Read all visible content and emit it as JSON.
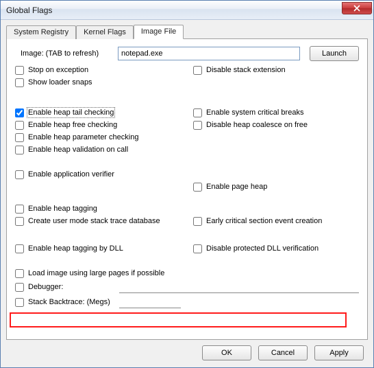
{
  "window": {
    "title": "Global Flags"
  },
  "tabs": {
    "registry": "System Registry",
    "kernel": "Kernel Flags",
    "imagefile": "Image File"
  },
  "image": {
    "label": "Image: (TAB to refresh)",
    "value": "notepad.exe",
    "launch": "Launch"
  },
  "opts": {
    "stop_exception": "Stop on exception",
    "show_loader": "Show loader snaps",
    "disable_stack_ext": "Disable stack extension",
    "heap_tail": "Enable heap tail checking",
    "heap_free": "Enable heap free checking",
    "heap_param": "Enable heap parameter checking",
    "heap_valid": "Enable heap validation on call",
    "sys_crit": "Enable system critical breaks",
    "disable_coalesce": "Disable heap coalesce on free",
    "app_verifier": "Enable application verifier",
    "page_heap": "Enable page heap",
    "heap_tag": "Enable heap tagging",
    "user_stack": "Create user mode stack trace database",
    "early_crit": "Early critical section event creation",
    "heap_tag_dll": "Enable heap tagging by DLL",
    "disable_prot_dll": "Disable protected DLL verification",
    "large_pages": "Load image using large pages if possible",
    "debugger": "Debugger:",
    "stack_bt": "Stack Backtrace: (Megs)"
  },
  "debugger_value": "",
  "stack_bt_value": "",
  "buttons": {
    "ok": "OK",
    "cancel": "Cancel",
    "apply": "Apply"
  }
}
